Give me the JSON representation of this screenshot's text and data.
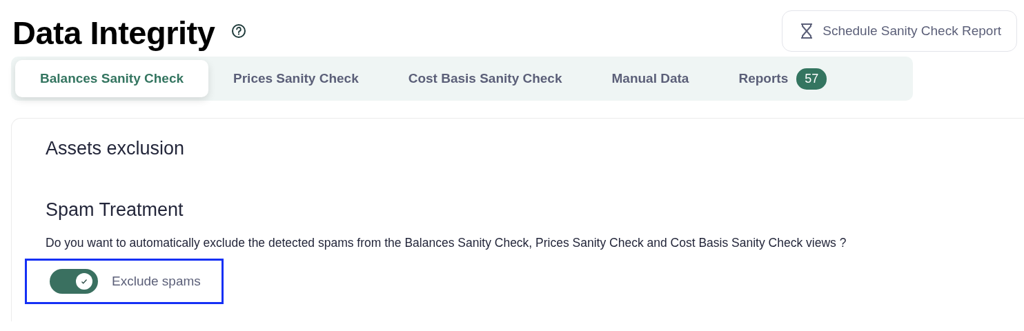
{
  "page": {
    "title": "Data Integrity"
  },
  "schedule_button": {
    "label": "Schedule Sanity Check Report"
  },
  "tabs": [
    {
      "label": "Balances Sanity Check",
      "selected": true
    },
    {
      "label": "Prices Sanity Check",
      "selected": false
    },
    {
      "label": "Cost Basis Sanity Check",
      "selected": false
    },
    {
      "label": "Manual Data",
      "selected": false
    },
    {
      "label": "Reports",
      "selected": false,
      "badge": "57"
    }
  ],
  "card": {
    "heading": "Assets exclusion",
    "section": {
      "title": "Spam Treatment",
      "description": "Do you want to automatically exclude the detected spams from the Balances Sanity Check, Prices Sanity Check and Cost Basis Sanity Check views ?",
      "toggle": {
        "label": "Exclude spams",
        "on": true,
        "highlighted": true
      }
    }
  }
}
